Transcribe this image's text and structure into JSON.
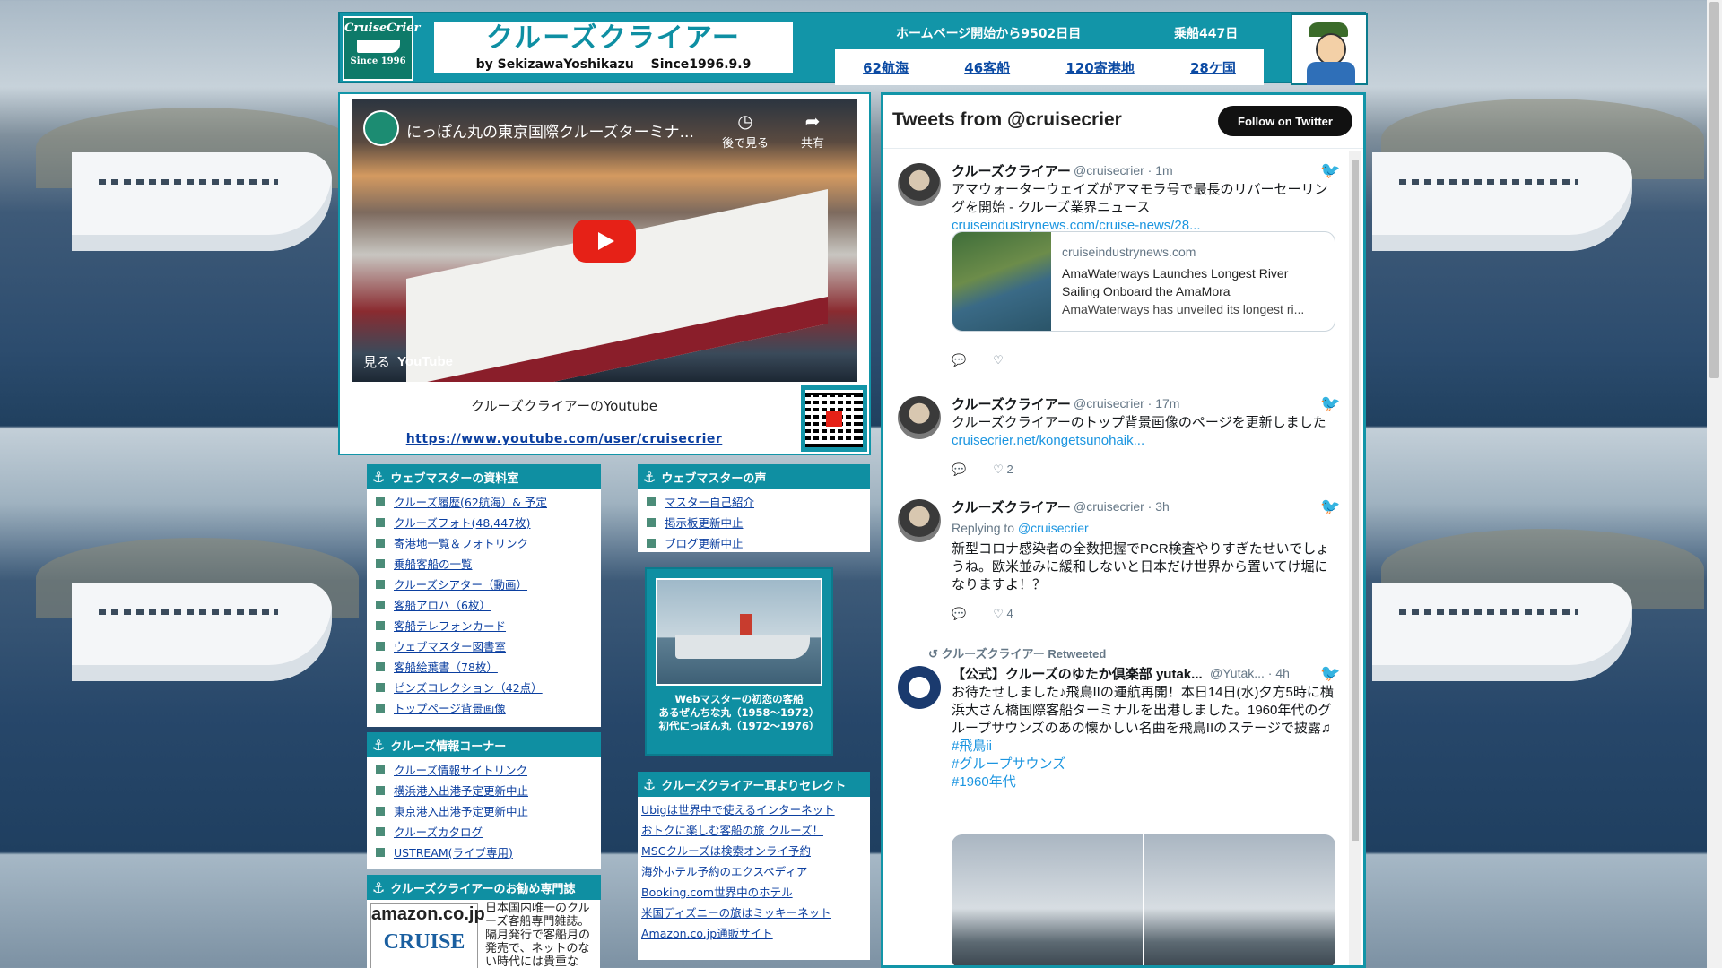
{
  "header": {
    "logo": {
      "name": "CruiseCrier",
      "since": "Since 1996"
    },
    "site_title": "クルーズクライアー",
    "byline": "by SekizawaYoshikazu　 Since1996.9.9",
    "days_text": "ホームページ開始から9502日目",
    "boarding_text": "乗船447日",
    "stats": [
      "62航海",
      "46客船",
      "120寄港地",
      "28ケ国"
    ]
  },
  "youtube": {
    "video_title": "にっぽん丸の東京国際クルーズターミナ...",
    "watch_later": "後で見る",
    "share": "共有",
    "watch_on": "見る",
    "yt_logo": "YouTube",
    "caption": "クルーズクライアーのYoutube",
    "url": "https://www.youtube.com/user/cruisecrier"
  },
  "menus": {
    "archive": {
      "title": "ウェブマスターの資料室",
      "items": [
        "クルーズ履歴(62航海）& 予定",
        "クルーズフォト(48,447枚)",
        "寄港地一覧＆フォトリンク",
        "乗船客船の一覧",
        "クルーズシアター（動画）",
        "客船アロハ（6枚）",
        "客船テレフォンカード",
        "ウェブマスター図書室",
        "客船絵葉書（78枚）",
        "ピンズコレクション（42点）",
        "トップページ背景画像"
      ]
    },
    "voice": {
      "title": "ウェブマスターの声",
      "items": [
        "マスター自己紹介",
        "掲示板更新中止",
        "ブログ更新中止"
      ]
    },
    "info": {
      "title": "クルーズ情報コーナー",
      "items": [
        "クルーズ情報サイトリンク",
        "横浜港入出港予定更新中止",
        "東京港入出港予定更新中止",
        "クルーズカタログ",
        "USTREAM(ライブ専用)"
      ]
    },
    "select": {
      "title": "クルーズクライアー耳よりセレクト",
      "items": [
        "Ubigは世界中で使えるインターネット",
        "おトクに楽しむ客船の旅 クルーズ！",
        "MSCクルーズは検索オンライ予約",
        "海外ホテル予約のエクスペディア",
        "Booking.com世界中のホテル",
        "米国ディズニーの旅はミッキーネット",
        "Amazon.co.jp通販サイト"
      ]
    },
    "magazine": {
      "title": "クルーズクライアーのお勧め専門誌",
      "amazon": "amazon.co.jp",
      "cruise": "CRUISE",
      "desc": "日本国内唯一のクルーズ客船専門雑誌。隔月発行で客船月の発売で、ネットのない時代には貴重な"
    }
  },
  "ship_card": {
    "caption_l1": "Webマスターの初恋の客船",
    "caption_l2": "あるぜんちな丸（1958～1972）",
    "caption_l3": "初代にっぽん丸（1972～1976）"
  },
  "twitter": {
    "header": "Tweets from @cruisecrier",
    "follow": "Follow on Twitter",
    "tweets": [
      {
        "name": "クルーズクライアー",
        "meta": "@cruisecrier · 1m",
        "text": "アマウォーターウェイズがアマモラ号で最長のリバーセーリングを開始 - クルーズ業界ニュース",
        "link": "cruiseindustrynews.com/cruise-news/28...",
        "card_domain": "cruiseindustrynews.com",
        "card_title": "AmaWaterways Launches Longest River Sailing Onboard the AmaMora",
        "card_desc": "AmaWaterways has unveiled its longest ri...",
        "likes": ""
      },
      {
        "name": "クルーズクライアー",
        "meta": "@cruisecrier · 17m",
        "text": "クルーズクライアーのトップ背景画像のページを更新しました",
        "link": "cruisecrier.net/kongetsunohaik...",
        "likes": "2"
      },
      {
        "name": "クルーズクライアー",
        "meta": "@cruisecrier · 3h",
        "reply_prefix": "Replying to ",
        "reply_to": "@cruisecrier",
        "text": "新型コロナ感染者の全数把握でPCR検査やりすぎたせいでしょうね。欧米並みに緩和しないと日本だけ世界から置いてけ堀になりますよ！？",
        "likes": "4"
      },
      {
        "retweeted_by": "クルーズクライアー Retweeted",
        "name": "【公式】クルーズのゆたか倶楽部 yutak...",
        "meta": "@Yutak... · 4h",
        "text": "お待たせしました♪飛鳥IIの運航再開！本日14日(水)夕方5時に横浜大さん橋国際客船ターミナルを出港しました。1960年代のグループサウンズのあの懐かしい名曲を飛鳥IIのステージで披露♫",
        "tags": [
          "#飛鳥ii",
          "#グループサウンズ",
          "#1960年代"
        ]
      }
    ]
  }
}
